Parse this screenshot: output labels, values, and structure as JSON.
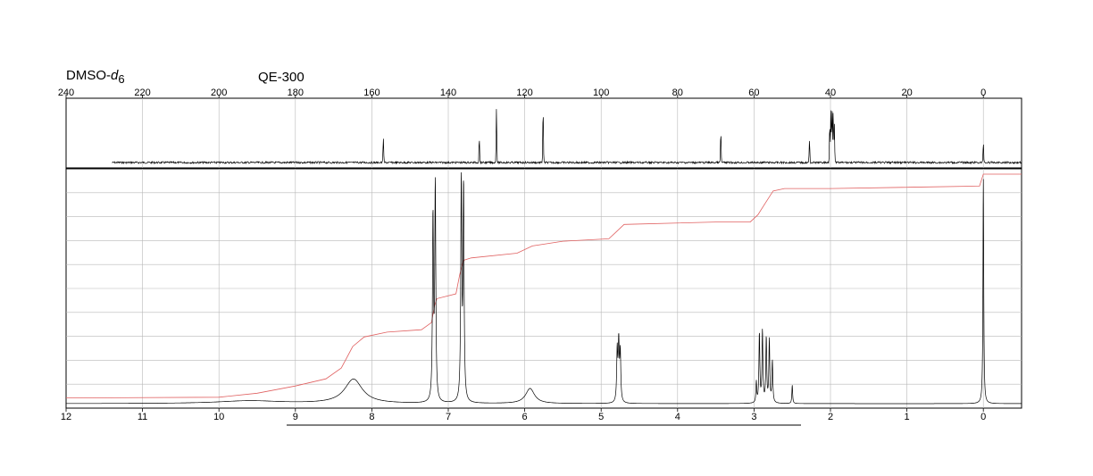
{
  "header": {
    "solvent_main": "DMSO-",
    "solvent_italic": "d",
    "solvent_sub": "6",
    "instrument": "QE-300"
  },
  "chart_data": [
    {
      "type": "line",
      "name": "13C spectrum",
      "xlim": [
        240,
        -10
      ],
      "x_ticks": [
        240,
        220,
        200,
        180,
        160,
        140,
        120,
        100,
        80,
        60,
        40,
        20,
        0
      ],
      "peaks": [
        {
          "x": 157.0,
          "h": 0.38
        },
        {
          "x": 131.9,
          "h": 0.38
        },
        {
          "x": 127.4,
          "h": 0.81
        },
        {
          "x": 115.2,
          "h": 0.81
        },
        {
          "x": 68.7,
          "h": 0.46
        },
        {
          "x": 45.5,
          "h": 0.34
        },
        {
          "x": 40.2,
          "h": 0.58
        },
        {
          "x": 39.9,
          "h": 0.8
        },
        {
          "x": 39.6,
          "h": 0.84
        },
        {
          "x": 39.3,
          "h": 0.8
        },
        {
          "x": 39.0,
          "h": 0.58
        },
        {
          "x": 0.0,
          "h": 0.3
        }
      ],
      "color": "#000000"
    },
    {
      "type": "line",
      "name": "1H spectrum",
      "xlim": [
        12,
        -0.5
      ],
      "x_ticks": [
        12,
        11,
        10,
        9,
        8,
        7,
        6,
        5,
        4,
        3,
        2,
        1,
        0
      ],
      "peaks": [
        {
          "x": 8.24,
          "h": 0.105,
          "w": 0.14
        },
        {
          "x": 9.6,
          "h": 0.012,
          "w": 0.5
        },
        {
          "x": 7.2,
          "h": 0.79,
          "w": 0.008
        },
        {
          "x": 7.17,
          "h": 0.93,
          "w": 0.008
        },
        {
          "x": 6.83,
          "h": 0.95,
          "w": 0.008
        },
        {
          "x": 6.8,
          "h": 0.92,
          "w": 0.008
        },
        {
          "x": 5.93,
          "h": 0.065,
          "w": 0.07
        },
        {
          "x": 4.79,
          "h": 0.22,
          "w": 0.008
        },
        {
          "x": 4.77,
          "h": 0.25,
          "w": 0.008
        },
        {
          "x": 4.75,
          "h": 0.21,
          "w": 0.008
        },
        {
          "x": 2.97,
          "h": 0.09,
          "w": 0.006
        },
        {
          "x": 2.93,
          "h": 0.3,
          "w": 0.007
        },
        {
          "x": 2.89,
          "h": 0.31,
          "w": 0.007
        },
        {
          "x": 2.84,
          "h": 0.28,
          "w": 0.007
        },
        {
          "x": 2.8,
          "h": 0.27,
          "w": 0.007
        },
        {
          "x": 2.76,
          "h": 0.18,
          "w": 0.007
        },
        {
          "x": 2.5,
          "h": 0.08,
          "w": 0.006
        },
        {
          "x": 0.0,
          "h": 0.98,
          "w": 0.006
        }
      ],
      "integral": [
        [
          12.0,
          0.035
        ],
        [
          10.0,
          0.038
        ],
        [
          9.5,
          0.055
        ],
        [
          9.0,
          0.085
        ],
        [
          8.6,
          0.115
        ],
        [
          8.4,
          0.16
        ],
        [
          8.25,
          0.25
        ],
        [
          8.1,
          0.29
        ],
        [
          7.8,
          0.31
        ],
        [
          7.35,
          0.32
        ],
        [
          7.22,
          0.35
        ],
        [
          7.18,
          0.42
        ],
        [
          7.15,
          0.45
        ],
        [
          6.9,
          0.47
        ],
        [
          6.85,
          0.55
        ],
        [
          6.8,
          0.61
        ],
        [
          6.7,
          0.62
        ],
        [
          6.1,
          0.64
        ],
        [
          5.9,
          0.67
        ],
        [
          5.5,
          0.69
        ],
        [
          4.9,
          0.7
        ],
        [
          4.8,
          0.73
        ],
        [
          4.7,
          0.76
        ],
        [
          3.5,
          0.77
        ],
        [
          3.05,
          0.77
        ],
        [
          2.95,
          0.8
        ],
        [
          2.85,
          0.85
        ],
        [
          2.75,
          0.9
        ],
        [
          2.6,
          0.91
        ],
        [
          2.0,
          0.91
        ],
        [
          0.05,
          0.92
        ],
        [
          0.0,
          0.97
        ],
        [
          -0.5,
          0.97
        ]
      ],
      "color": "#000000",
      "integral_color": "#e06060"
    }
  ]
}
